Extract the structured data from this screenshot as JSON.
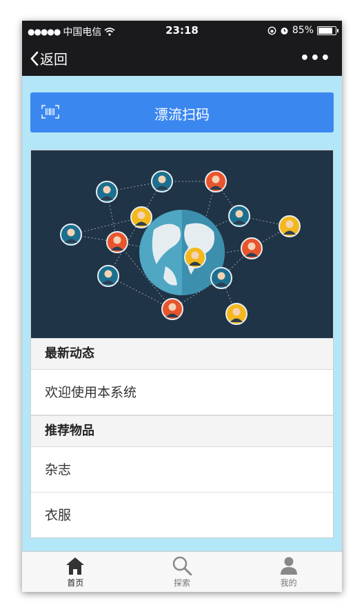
{
  "status_bar": {
    "carrier": "中国电信",
    "time": "23:18",
    "battery": "85%",
    "battery_level": 0.85
  },
  "nav": {
    "back_label": "返回",
    "more_label": "•••"
  },
  "scan_button": {
    "label": "漂流扫码",
    "icon": "barcode-scan-icon"
  },
  "banner": {
    "icon": "world-network-illustration"
  },
  "sections": [
    {
      "title": "最新动态",
      "items": [
        "欢迎使用本系统"
      ]
    },
    {
      "title": "推荐物品",
      "items": [
        "杂志",
        "衣服"
      ]
    }
  ],
  "tabbar": {
    "tabs": [
      {
        "label": "首页",
        "icon": "home-icon",
        "active": true
      },
      {
        "label": "探索",
        "icon": "search-icon",
        "active": false
      },
      {
        "label": "我的",
        "icon": "user-icon",
        "active": false
      }
    ]
  },
  "colors": {
    "page_bg": "#b3e6f7",
    "bar_bg": "#1a1a1c",
    "accent": "#3b87f0",
    "banner_bg": "#1f3446"
  }
}
